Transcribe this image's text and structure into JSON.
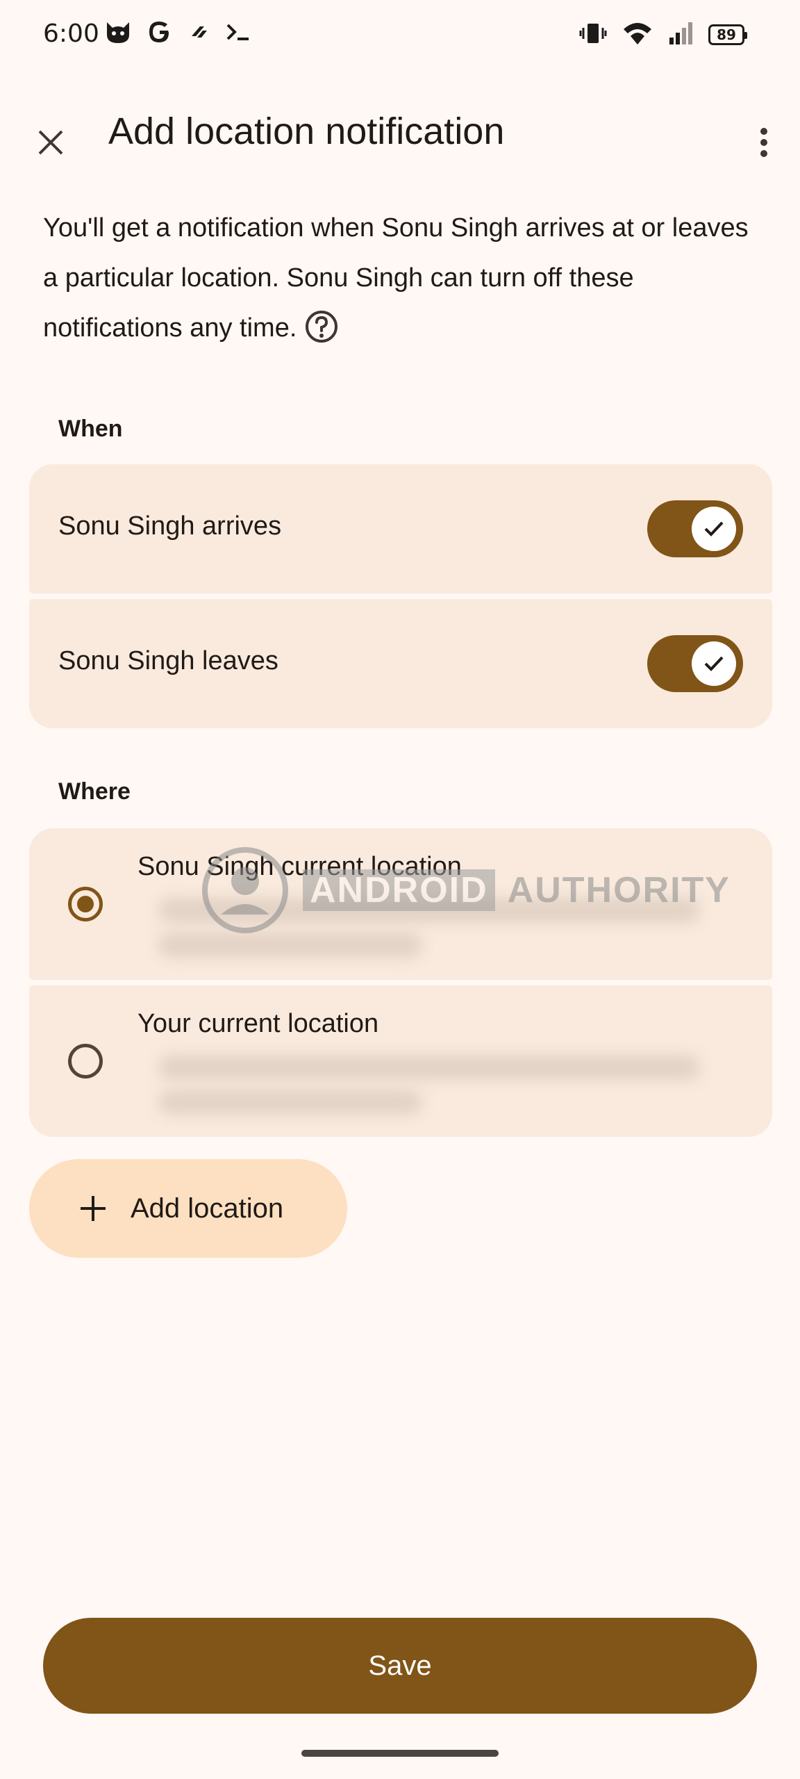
{
  "status_bar": {
    "time": "6:00",
    "left_icons": [
      "cat-notification-icon",
      "google-icon",
      "feedly-icon",
      "terminal-icon"
    ],
    "right_icons": [
      "vibrate-icon",
      "wifi-icon",
      "signal-icon"
    ],
    "battery_level": "89"
  },
  "app_bar": {
    "title": "Add location notification",
    "close_icon": "close-icon",
    "more_icon": "more-vert-icon"
  },
  "description": "You'll get a notification when Sonu Singh arrives at or leaves a particular location. Sonu Singh can turn off these notifications any time.",
  "when_section": {
    "label": "When",
    "options": [
      {
        "label": "Sonu Singh arrives",
        "enabled": true
      },
      {
        "label": "Sonu Singh leaves",
        "enabled": true
      }
    ]
  },
  "where_section": {
    "label": "Where",
    "options": [
      {
        "label": "Sonu Singh current location",
        "selected": true
      },
      {
        "label": "Your current location",
        "selected": false
      }
    ]
  },
  "add_location": {
    "label": "Add location",
    "icon": "plus-icon"
  },
  "save_button": {
    "label": "Save"
  },
  "watermark": {
    "text_a": "ANDROID",
    "text_b": "AUTHORITY"
  },
  "colors": {
    "background": "#fff8f4",
    "card": "#f9eadd",
    "accent": "#815417",
    "add_location_bg": "#fde0c1"
  }
}
